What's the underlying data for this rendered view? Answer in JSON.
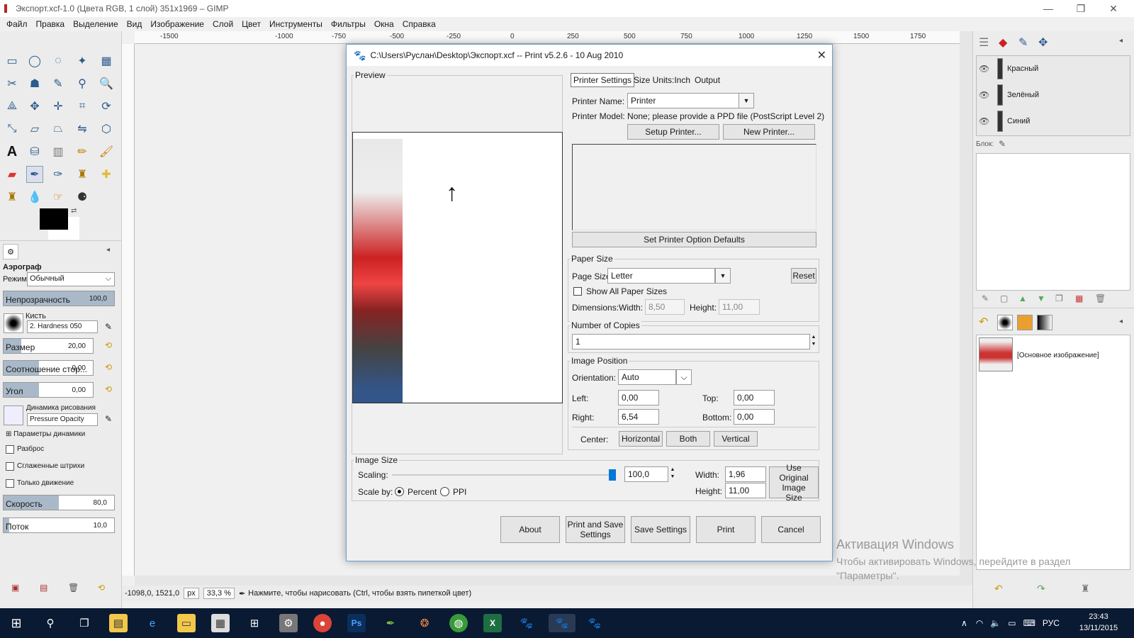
{
  "window": {
    "title": "Экспорт.xcf-1.0 (Цвета RGB, 1 слой) 351x1969 – GIMP",
    "minimize": "—",
    "restore": "❐",
    "close": "✕"
  },
  "menu": [
    "Файл",
    "Правка",
    "Выделение",
    "Вид",
    "Изображение",
    "Слой",
    "Цвет",
    "Инструменты",
    "Фильтры",
    "Окна",
    "Справка"
  ],
  "ruler_top": [
    "-1500",
    "-1000",
    "-750",
    "-500",
    "-250",
    "0",
    "250",
    "500",
    "750",
    "1000",
    "1250",
    "1500",
    "1750"
  ],
  "tool_options": {
    "tool_name": "Аэрограф",
    "mode_label": "Режим:",
    "mode_value": "Обычный",
    "opacity_label": "Непрозрачность",
    "opacity_value": "100,0",
    "opacity_level": 1.0,
    "brush_label": "Кисть",
    "brush_value": "2. Hardness 050",
    "size_label": "Размер",
    "size_value": "20,00",
    "size_level": 0.2,
    "aspect_label": "Соотношение стор...",
    "aspect_value": "0,00",
    "aspect_level": 0.4,
    "angle_label": "Угол",
    "angle_value": "0,00",
    "angle_level": 0.4,
    "dynamics_label": "Динамика рисования",
    "dynamics_value": "Pressure Opacity",
    "dynamics_options": "Параметры динамики",
    "scatter": "Разброс",
    "smooth": "Сглаженные штрихи",
    "motion_only": "Только движение",
    "rate_label": "Скорость",
    "rate_value": "80,0",
    "rate_level": 0.5,
    "flow_label": "Поток",
    "flow_value": "10,0",
    "flow_level": 0.05
  },
  "status": {
    "coords": "-1098,0, 1521,0",
    "unit": "px",
    "zoom": "33,3 %",
    "message": "Нажмите, чтобы нарисовать (Ctrl, чтобы взять пипеткой цвет)"
  },
  "layers": {
    "items": [
      "Красный",
      "Зелёный",
      "Синий"
    ],
    "lock_label": "Блок:"
  },
  "images_panel": {
    "item": "[Основное изображение]"
  },
  "dialog": {
    "title": "C:\\Users\\Руслан\\Desktop\\Экспорт.xcf -- Print v5.2.6 - 10 Aug 2010",
    "preview_label": "Preview",
    "tabs": [
      "Printer Settings",
      "Size Units:Inch",
      "Output"
    ],
    "printer_name_label": "Printer Name:",
    "printer_name_value": "Printer",
    "printer_model": "Printer Model: None; please provide a PPD file (PostScript Level 2)",
    "setup_printer": "Setup Printer...",
    "new_printer": "New Printer...",
    "set_defaults": "Set Printer Option Defaults",
    "paper_size_label": "Paper Size",
    "page_size_label": "Page Size",
    "page_size_value": "Letter",
    "reset": "Reset",
    "show_all_sizes": "Show All Paper Sizes",
    "dimensions_label": "Dimensions:Width:",
    "dim_width": "8,50",
    "height_label": "Height:",
    "dim_height": "11,00",
    "copies_label": "Number of Copies",
    "copies_value": "1",
    "image_position_label": "Image Position",
    "orientation_label": "Orientation:",
    "orientation_value": "Auto",
    "left_label": "Left:",
    "left_value": "0,00",
    "top_label": "Top:",
    "top_value": "0,00",
    "right_label": "Right:",
    "right_value": "6,54",
    "bottom_label": "Bottom:",
    "bottom_value": "0,00",
    "center_label": "Center:",
    "horizontal": "Horizontal",
    "both": "Both",
    "vertical": "Vertical",
    "image_size_label": "Image Size",
    "scaling_label": "Scaling:",
    "scaling_value": "100,0",
    "scaling_level": 1.0,
    "scale_by_label": "Scale by:",
    "percent": "Percent",
    "ppi": "PPI",
    "width_label": "Width:",
    "width_value": "1,96",
    "img_height_label": "Height:",
    "img_height_value": "11,00",
    "use_original": "Use Original Image Size",
    "about": "About",
    "print_save": "Print and Save Settings",
    "save_settings": "Save Settings",
    "print": "Print",
    "cancel": "Cancel"
  },
  "activation": {
    "title": "Активация Windows",
    "text": "Чтобы активировать Windows, перейдите в раздел \"Параметры\"."
  },
  "taskbar": {
    "lang": "РУС",
    "time": "23:43",
    "date": "13/11/2015"
  }
}
